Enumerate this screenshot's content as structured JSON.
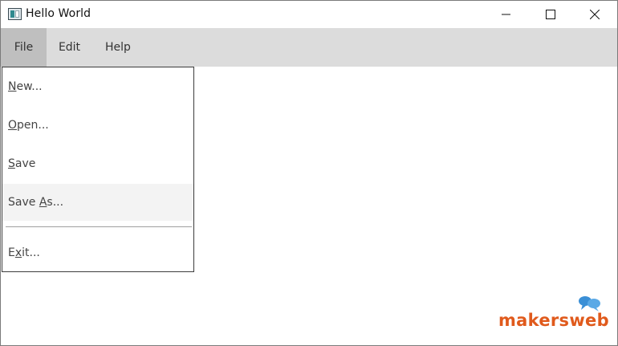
{
  "window": {
    "title": "Hello World"
  },
  "menubar": {
    "items": [
      {
        "label": "File",
        "active": true
      },
      {
        "label": "Edit",
        "active": false
      },
      {
        "label": "Help",
        "active": false
      }
    ]
  },
  "file_menu": {
    "items": [
      {
        "label": "New...",
        "mnemonic": "N"
      },
      {
        "label": "Open...",
        "mnemonic": "O"
      },
      {
        "label": "Save",
        "mnemonic": "S"
      },
      {
        "label": "Save As...",
        "mnemonic": "A",
        "highlighted": true
      },
      {
        "separator": true
      },
      {
        "label": "Exit...",
        "mnemonic": "x"
      }
    ]
  },
  "watermark": {
    "text": "makersweb"
  },
  "colors": {
    "menubar_bg": "#dcdcdc",
    "active_menu_bg": "#bfbfbf",
    "highlight_bg": "#f3f3f3",
    "brand_orange": "#e05a1c",
    "brand_blue": "#3a8fd6"
  }
}
